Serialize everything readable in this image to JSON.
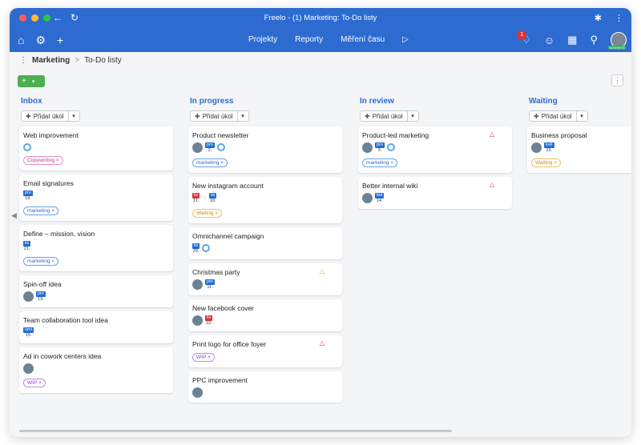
{
  "window": {
    "title": "Freelo - (1) Marketing: To-Do listy",
    "back_icon": "arrow-left-icon",
    "reload_icon": "reload-icon",
    "colors": {
      "bar": "#2d6bd0",
      "close": "#ff5f57",
      "min": "#febc2e",
      "max": "#28c840"
    }
  },
  "nav": {
    "items": [
      "Projekty",
      "Reporty",
      "Měření času"
    ],
    "notifications": "1",
    "business_label": "BUSINESS"
  },
  "breadcrumb": {
    "project": "Marketing",
    "list": "To-Do listy",
    "separator": ">"
  },
  "toolbar": {
    "add_symbol": "+",
    "dropdown_symbol": "▾",
    "menu_symbol": "⋮"
  },
  "add_task_label": "Přidat úkol",
  "columns": [
    {
      "title": "Inbox",
      "cards": [
        {
          "title": "Web improvement",
          "ring": true,
          "tag": "Copywriting",
          "tag_type": "copy"
        },
        {
          "title": "Email signatures",
          "date": {
            "m": "pro",
            "d": "19."
          },
          "tag": "marketing",
          "tag_type": "marketing"
        },
        {
          "title": "Define – mission, vision",
          "date": {
            "m": "lis",
            "d": "21."
          },
          "tag": "marketing",
          "tag_type": "marketing"
        },
        {
          "title": "Spin-off idea",
          "avatar": true,
          "date": {
            "m": "pro",
            "d": "19."
          }
        },
        {
          "title": "Team collaboration tool idea",
          "date": {
            "m": "úno",
            "d": "15."
          }
        },
        {
          "title": "Ad in cowork centers idea",
          "avatar": true,
          "tag": "WIP",
          "tag_type": "wip"
        }
      ]
    },
    {
      "title": "In progress",
      "cards": [
        {
          "title": "Product newsletter",
          "avatar": true,
          "date": {
            "m": "pro",
            "d": "2."
          },
          "ring": true,
          "tag": "marketing",
          "tag_type": "marketing"
        },
        {
          "title": "New instagram account",
          "date_from": {
            "m": "lis",
            "d": "11."
          },
          "date": {
            "m": "lis",
            "d": "18."
          },
          "tag": "Waiting",
          "tag_type": "waiting"
        },
        {
          "title": "Omnichannel campaign",
          "date": {
            "m": "lis",
            "d": "29."
          },
          "ring": true
        },
        {
          "title": "Christmas party",
          "warn": "orange",
          "avatar": true,
          "date": {
            "m": "pro",
            "d": "11."
          }
        },
        {
          "title": "New facebook cover",
          "avatar": true,
          "date": {
            "m": "lis",
            "d": "13.",
            "red": true
          }
        },
        {
          "title": "Print logo for office foyer",
          "warn": "red",
          "tag": "WIP",
          "tag_type": "wip"
        },
        {
          "title": "PPC improvement",
          "avatar": true
        }
      ]
    },
    {
      "title": "In review",
      "cards": [
        {
          "title": "Product-led marketing",
          "warn": "red",
          "avatar": true,
          "date": {
            "m": "pro",
            "d": "3."
          },
          "ring": true,
          "tag": "marketing",
          "tag_type": "marketing"
        },
        {
          "title": "Better internal wiki",
          "warn": "red",
          "avatar": true,
          "date": {
            "m": "led",
            "d": "14."
          }
        }
      ]
    },
    {
      "title": "Waiting",
      "cards": [
        {
          "title": "Business proposal",
          "avatar": true,
          "date": {
            "m": "kvě",
            "d": "15."
          },
          "tag": "Waiting",
          "tag_type": "waiting"
        }
      ]
    }
  ]
}
